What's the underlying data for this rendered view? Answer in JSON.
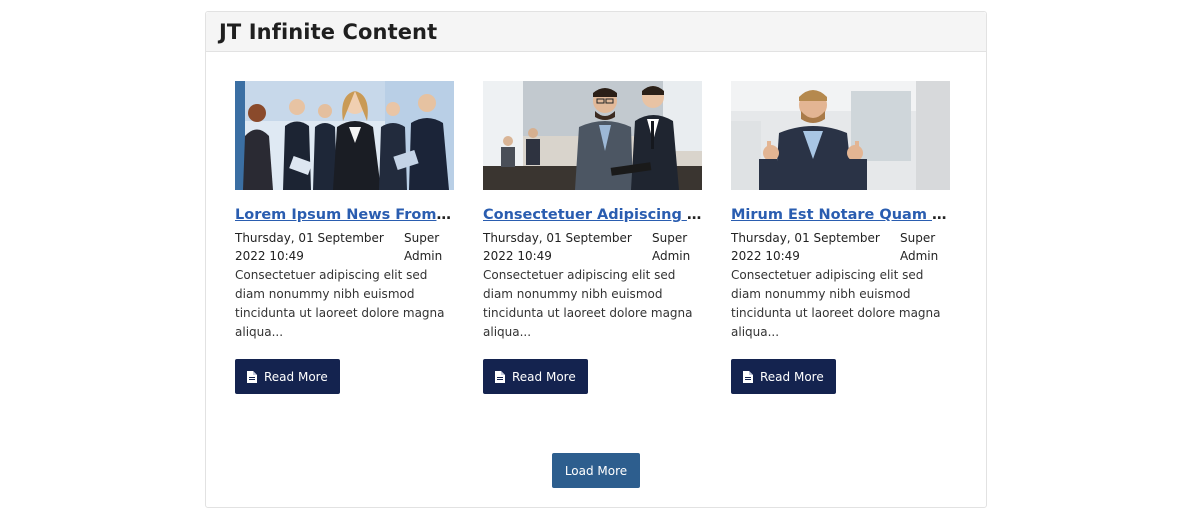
{
  "module": {
    "title": "JT Infinite Content"
  },
  "articles": [
    {
      "title": "Lorem Ipsum News From Us",
      "date": "Thursday, 01 September 2022 10:49",
      "author": "Super Admin",
      "intro": "Consectetuer adipiscing elit sed diam nonummy nibh euismod tincidunta ut laoreet dolore magna aliqua...",
      "read_more": "Read More",
      "image_icon": "business-team-photo"
    },
    {
      "title": "Consectetuer Adipiscing E...",
      "date": "Thursday, 01 September 2022 10:49",
      "author": "Super Admin",
      "intro": "Consectetuer adipiscing elit sed diam nonummy nibh euismod tincidunta ut laoreet dolore magna aliqua...",
      "read_more": "Read More",
      "image_icon": "business-meeting-photo"
    },
    {
      "title": "Mirum Est Notare Quam Lit...",
      "date": "Thursday, 01 September 2022 10:49",
      "author": "Super Admin",
      "intro": "Consectetuer adipiscing elit sed diam nonummy nibh euismod tincidunta ut laoreet dolore magna aliqua...",
      "read_more": "Read More",
      "image_icon": "businessman-portrait-photo"
    }
  ],
  "load_more": "Load More",
  "colors": {
    "link": "#2a5db0",
    "read_more_bg": "#14234f",
    "load_more_bg": "#2d5e8e",
    "header_bg": "#f5f5f5",
    "border": "#e2e2e2"
  }
}
